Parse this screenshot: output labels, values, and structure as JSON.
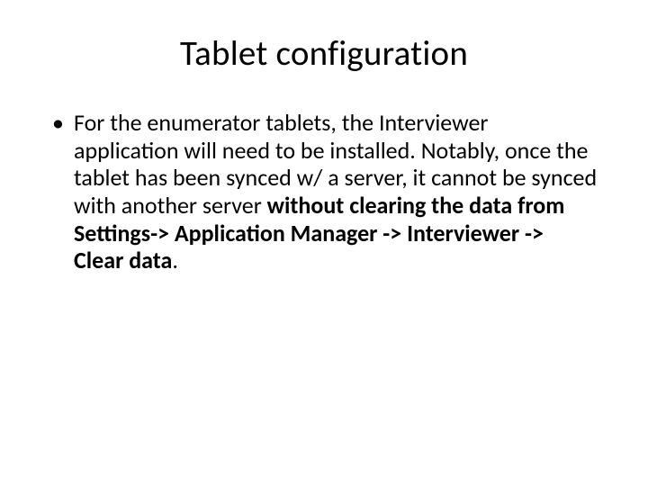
{
  "title": "Tablet configuration",
  "bullet": {
    "part1": "For the enumerator tablets, the Interviewer application will need to be installed. Notably, once the tablet has been synced w/ a server, it cannot be synced with another server ",
    "part2_bold": "without clearing the data from Settings-> Application Manager -> Interviewer -> Clear data",
    "part3": "."
  }
}
